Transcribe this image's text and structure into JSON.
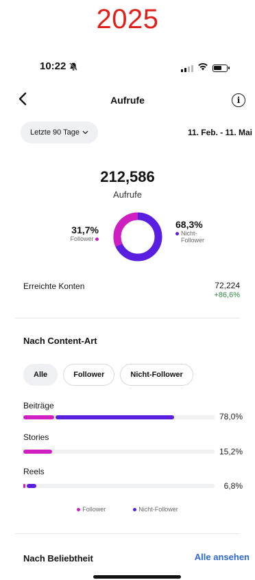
{
  "overlay_year": "2025",
  "status": {
    "time": "10:22"
  },
  "nav": {
    "back": "‹",
    "title": "Aufrufe",
    "info": "i"
  },
  "range": {
    "label": "Letzte 90 Tage",
    "chevron": "⌵",
    "dates": "11. Feb. - 11. Mai"
  },
  "summary": {
    "total": "212,586",
    "total_label": "Aufrufe",
    "follower_pct": "31,7%",
    "follower_label": "Follower",
    "nonfollower_pct": "68,3%",
    "nonfollower_label": "Nicht-Follower",
    "follower_fraction": 0.317
  },
  "reach": {
    "label": "Erreichte Konten",
    "value": "72,224",
    "change": "+86,6%"
  },
  "content_type": {
    "title": "Nach Content-Art",
    "filters": [
      "Alle",
      "Follower",
      "Nicht-Follower"
    ],
    "rows": [
      {
        "label": "Beiträge",
        "pct": "78,0%",
        "follower": 0.16,
        "nonfollower": 0.62
      },
      {
        "label": "Stories",
        "pct": "15,2%",
        "follower": 0.15,
        "nonfollower": 0.0
      },
      {
        "label": "Reels",
        "pct": "6,8%",
        "follower": 0.01,
        "nonfollower": 0.05
      }
    ],
    "legend": [
      "Follower",
      "Nicht-Follower"
    ]
  },
  "popularity": {
    "title": "Nach Beliebtheit",
    "see_all": "Alle ansehen"
  },
  "colors": {
    "follower": "#d01fc0",
    "nonfollower": "#5a1ee0",
    "year": "#e0201a",
    "link": "#2b66e0",
    "positive": "#2e8b3d"
  },
  "icons": {
    "back": "chevron-left-icon",
    "info": "info-icon",
    "bell": "bell-muted-icon",
    "signal": "cellular-signal-icon",
    "wifi": "wifi-icon",
    "battery": "battery-icon"
  }
}
